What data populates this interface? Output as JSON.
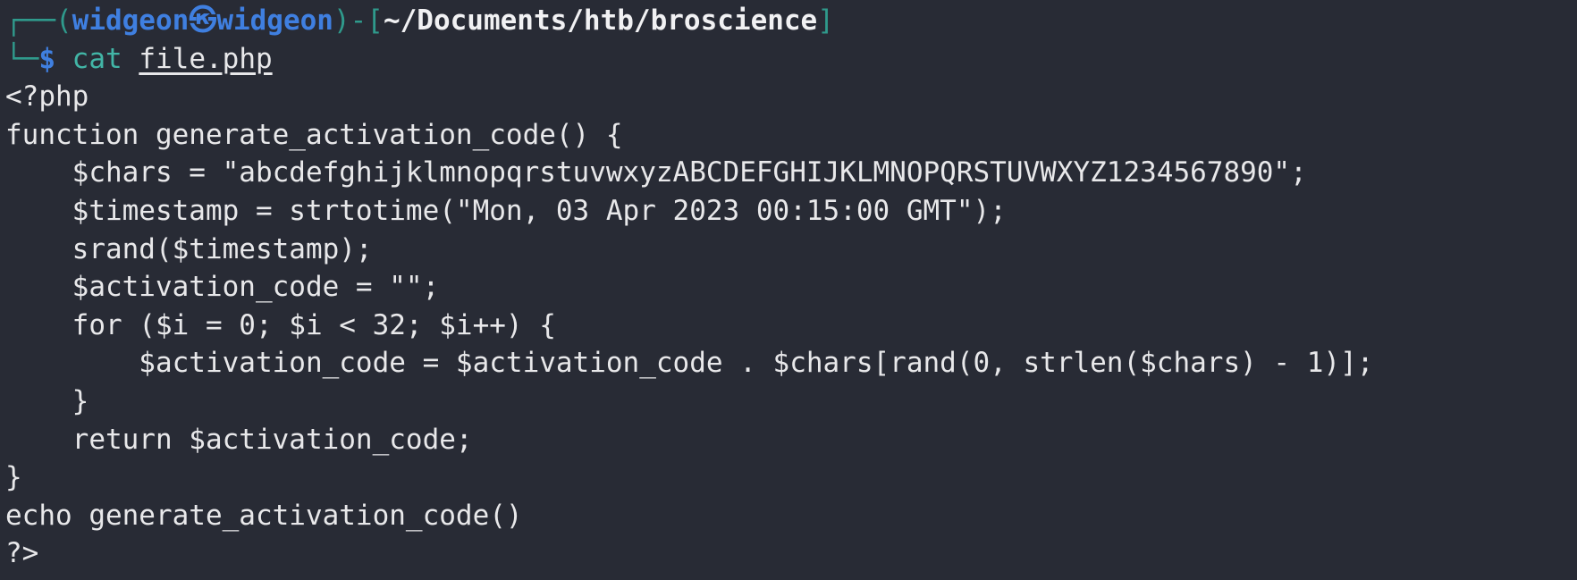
{
  "prompt": {
    "frame_top": "┌──(",
    "user": "widgeon",
    "at_symbol": "㉿",
    "host": "widgeon",
    "bracket_mid": ")-[",
    "cwd": "~/Documents/htb/broscience",
    "bracket_end": "]",
    "frame_bottom": "└─",
    "dollar": "$",
    "command": "cat",
    "argument": "file.php"
  },
  "output_lines": [
    "<?php",
    "function generate_activation_code() {",
    "    $chars = \"abcdefghijklmnopqrstuvwxyzABCDEFGHIJKLMNOPQRSTUVWXYZ1234567890\";",
    "    $timestamp = strtotime(\"Mon, 03 Apr 2023 00:15:00 GMT\");",
    "    srand($timestamp);",
    "    $activation_code = \"\";",
    "    for ($i = 0; $i < 32; $i++) {",
    "        $activation_code = $activation_code . $chars[rand(0, strlen($chars) - 1)];",
    "    }",
    "    return $activation_code;",
    "}",
    "echo generate_activation_code()",
    "?>"
  ]
}
